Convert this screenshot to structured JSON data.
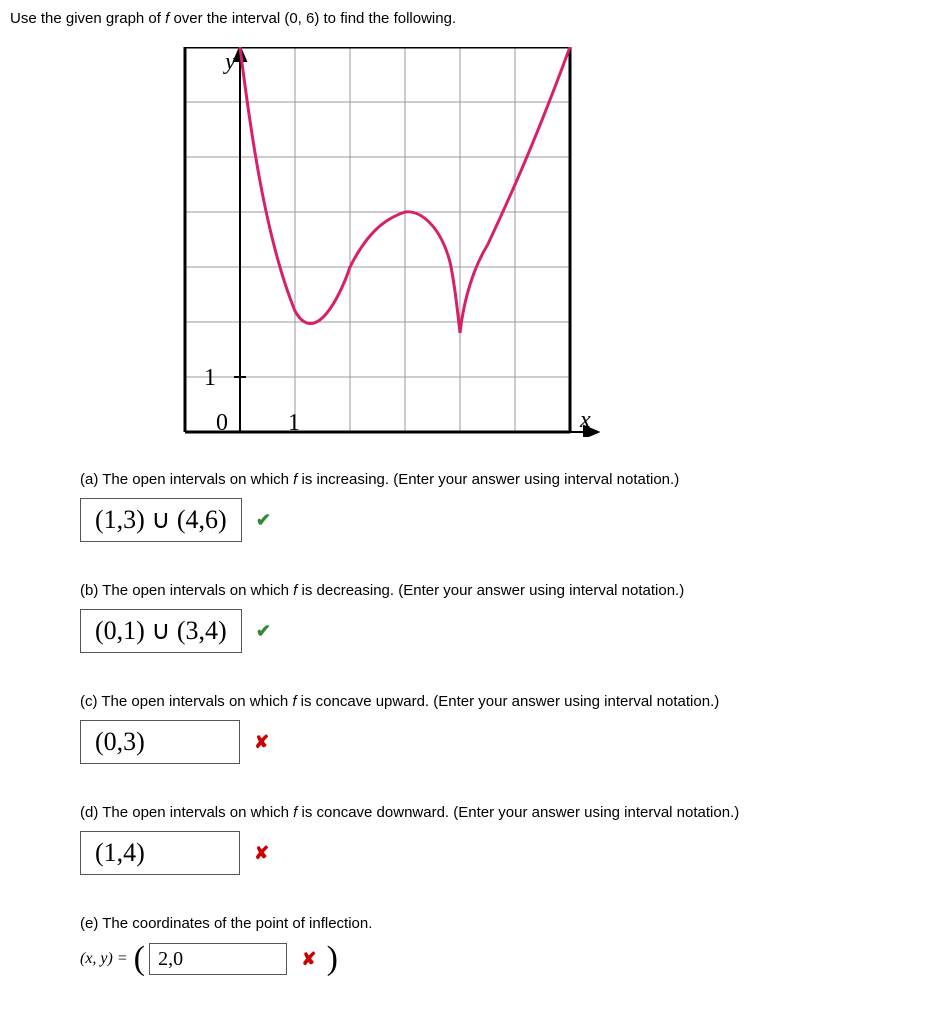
{
  "instruction_pre": "Use the given graph of ",
  "instruction_f": "f",
  "instruction_post": " over the interval (0, 6) to find the following.",
  "graph": {
    "y_label": "y",
    "x_label": "x",
    "tick_y": "1",
    "origin": "0",
    "tick_x": "1"
  },
  "parts": {
    "a": {
      "label": "(a) The open intervals on which ",
      "f": "f",
      "tail": " is increasing. (Enter your answer using interval notation.)",
      "answer": "(1,3) ∪ (4,6)",
      "correct": true
    },
    "b": {
      "label": "(b) The open intervals on which ",
      "f": "f",
      "tail": " is decreasing. (Enter your answer using interval notation.)",
      "answer": "(0,1) ∪ (3,4)",
      "correct": true
    },
    "c": {
      "label": "(c) The open intervals on which ",
      "f": "f",
      "tail": " is concave upward. (Enter your answer using interval notation.)",
      "answer": "(0,3)",
      "correct": false
    },
    "d": {
      "label": "(d) The open intervals on which ",
      "f": "f",
      "tail": " is concave downward. (Enter your answer using interval notation.)",
      "answer": "(1,4)",
      "correct": false
    },
    "e": {
      "label": "(e) The coordinates of the point of inflection.",
      "xy": "(x, y) = ",
      "answer": "2,0",
      "correct": false
    }
  },
  "chart_data": {
    "type": "line",
    "title": "",
    "xlabel": "x",
    "ylabel": "y",
    "xlim": [
      -1,
      6
    ],
    "ylim": [
      0,
      7
    ],
    "x": [
      0,
      0.5,
      1,
      1.5,
      2,
      2.5,
      3,
      3.5,
      4,
      4.5,
      5,
      5.5,
      6
    ],
    "y": [
      7.0,
      4.0,
      2.2,
      2.4,
      3.0,
      3.7,
      4.0,
      3.7,
      1.8,
      3.4,
      4.7,
      5.9,
      7.0
    ],
    "grid": true
  }
}
